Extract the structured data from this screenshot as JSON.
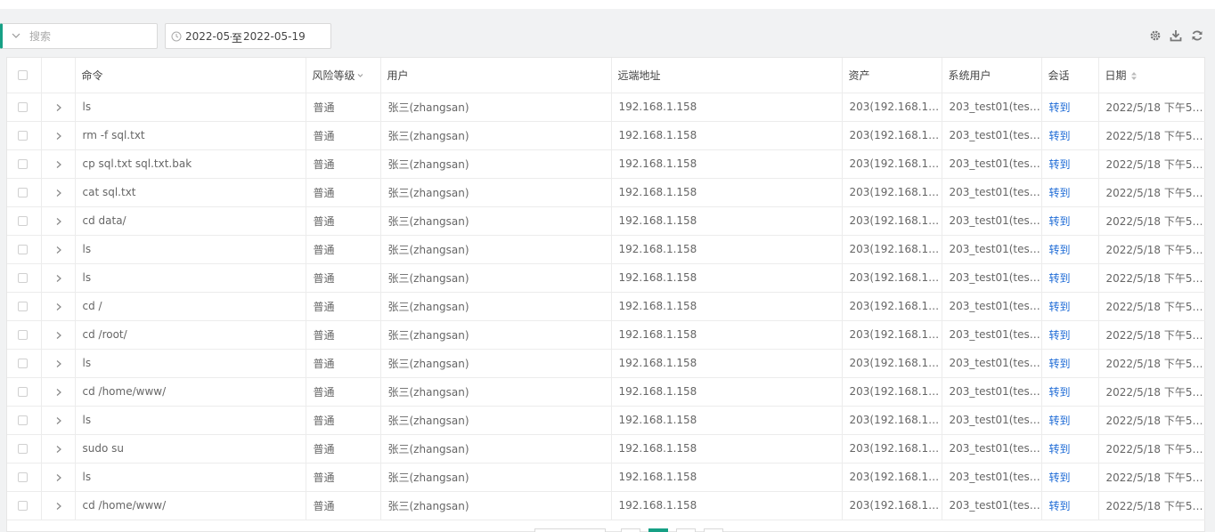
{
  "search": {
    "placeholder": "搜索",
    "value": ""
  },
  "date_range": {
    "start": "2022-05-1",
    "separator": "至",
    "end": "2022-05-19"
  },
  "toolbar_icons": [
    "gear-icon",
    "download-icon",
    "refresh-icon"
  ],
  "accent_color": "#16a085",
  "table": {
    "headers": {
      "command": "命令",
      "risk": "风险等级",
      "user": "用户",
      "remote": "远端地址",
      "asset": "资产",
      "system_user": "系统用户",
      "session": "会话",
      "date": "日期"
    },
    "rows": [
      {
        "command": "ls",
        "risk": "普通",
        "user": "张三(zhangsan)",
        "remote": "192.168.1.158",
        "asset": "203(192.168.1.…",
        "system_user": "203_test01(tes…",
        "session": "转到",
        "date": "2022/5/18 下午5…"
      },
      {
        "command": "rm -f sql.txt",
        "risk": "普通",
        "user": "张三(zhangsan)",
        "remote": "192.168.1.158",
        "asset": "203(192.168.1.…",
        "system_user": "203_test01(tes…",
        "session": "转到",
        "date": "2022/5/18 下午5…"
      },
      {
        "command": "cp sql.txt sql.txt.bak",
        "risk": "普通",
        "user": "张三(zhangsan)",
        "remote": "192.168.1.158",
        "asset": "203(192.168.1.…",
        "system_user": "203_test01(tes…",
        "session": "转到",
        "date": "2022/5/18 下午5…"
      },
      {
        "command": "cat sql.txt",
        "risk": "普通",
        "user": "张三(zhangsan)",
        "remote": "192.168.1.158",
        "asset": "203(192.168.1.…",
        "system_user": "203_test01(tes…",
        "session": "转到",
        "date": "2022/5/18 下午5…"
      },
      {
        "command": "cd data/",
        "risk": "普通",
        "user": "张三(zhangsan)",
        "remote": "192.168.1.158",
        "asset": "203(192.168.1.…",
        "system_user": "203_test01(tes…",
        "session": "转到",
        "date": "2022/5/18 下午5…"
      },
      {
        "command": "ls",
        "risk": "普通",
        "user": "张三(zhangsan)",
        "remote": "192.168.1.158",
        "asset": "203(192.168.1.…",
        "system_user": "203_test01(tes…",
        "session": "转到",
        "date": "2022/5/18 下午5…"
      },
      {
        "command": "ls",
        "risk": "普通",
        "user": "张三(zhangsan)",
        "remote": "192.168.1.158",
        "asset": "203(192.168.1.…",
        "system_user": "203_test01(tes…",
        "session": "转到",
        "date": "2022/5/18 下午5…"
      },
      {
        "command": "cd /",
        "risk": "普通",
        "user": "张三(zhangsan)",
        "remote": "192.168.1.158",
        "asset": "203(192.168.1.…",
        "system_user": "203_test01(tes…",
        "session": "转到",
        "date": "2022/5/18 下午5…"
      },
      {
        "command": "cd /root/",
        "risk": "普通",
        "user": "张三(zhangsan)",
        "remote": "192.168.1.158",
        "asset": "203(192.168.1.…",
        "system_user": "203_test01(tes…",
        "session": "转到",
        "date": "2022/5/18 下午5…"
      },
      {
        "command": "ls",
        "risk": "普通",
        "user": "张三(zhangsan)",
        "remote": "192.168.1.158",
        "asset": "203(192.168.1.…",
        "system_user": "203_test01(tes…",
        "session": "转到",
        "date": "2022/5/18 下午5…"
      },
      {
        "command": "cd /home/www/",
        "risk": "普通",
        "user": "张三(zhangsan)",
        "remote": "192.168.1.158",
        "asset": "203(192.168.1.…",
        "system_user": "203_test01(tes…",
        "session": "转到",
        "date": "2022/5/18 下午5…"
      },
      {
        "command": "ls",
        "risk": "普通",
        "user": "张三(zhangsan)",
        "remote": "192.168.1.158",
        "asset": "203(192.168.1.…",
        "system_user": "203_test01(tes…",
        "session": "转到",
        "date": "2022/5/18 下午5…"
      },
      {
        "command": "sudo su",
        "risk": "普通",
        "user": "张三(zhangsan)",
        "remote": "192.168.1.158",
        "asset": "203(192.168.1.…",
        "system_user": "203_test01(tes…",
        "session": "转到",
        "date": "2022/5/18 下午5…"
      },
      {
        "command": "ls",
        "risk": "普通",
        "user": "张三(zhangsan)",
        "remote": "192.168.1.158",
        "asset": "203(192.168.1.…",
        "system_user": "203_test01(tes…",
        "session": "转到",
        "date": "2022/5/18 下午5…"
      },
      {
        "command": "cd /home/www/",
        "risk": "普通",
        "user": "张三(zhangsan)",
        "remote": "192.168.1.158",
        "asset": "203(192.168.1.…",
        "system_user": "203_test01(tes…",
        "session": "转到",
        "date": "2022/5/18 下午5…"
      }
    ]
  }
}
